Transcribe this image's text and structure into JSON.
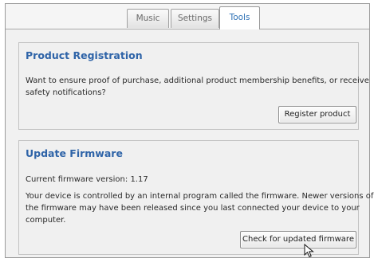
{
  "tabs": [
    "Music",
    "Settings",
    "Tools"
  ],
  "active_tab": "Tools",
  "registration": {
    "title": "Product Registration",
    "description_lines": [
      "Want to ensure proof of purchase, additional product membership benefits, or receive",
      "safety notifications?"
    ],
    "button_label": "Register product"
  },
  "firmware": {
    "title": "Update Firmware",
    "version_label": "Current firmware version:",
    "version_value": "1.17",
    "description_lines": [
      "Your device is controlled by an internal program called the firmware. Newer versions of",
      "the firmware may have been released since you last connected your device to your",
      "computer."
    ],
    "button_label": "Check for updated firmware"
  },
  "colors": {
    "title_blue": "#2f64a8",
    "active_tab_text": "#2f72b6",
    "panel_bg": "#f0f0f0"
  },
  "icons": {
    "pointer": "arrow-cursor-icon"
  }
}
